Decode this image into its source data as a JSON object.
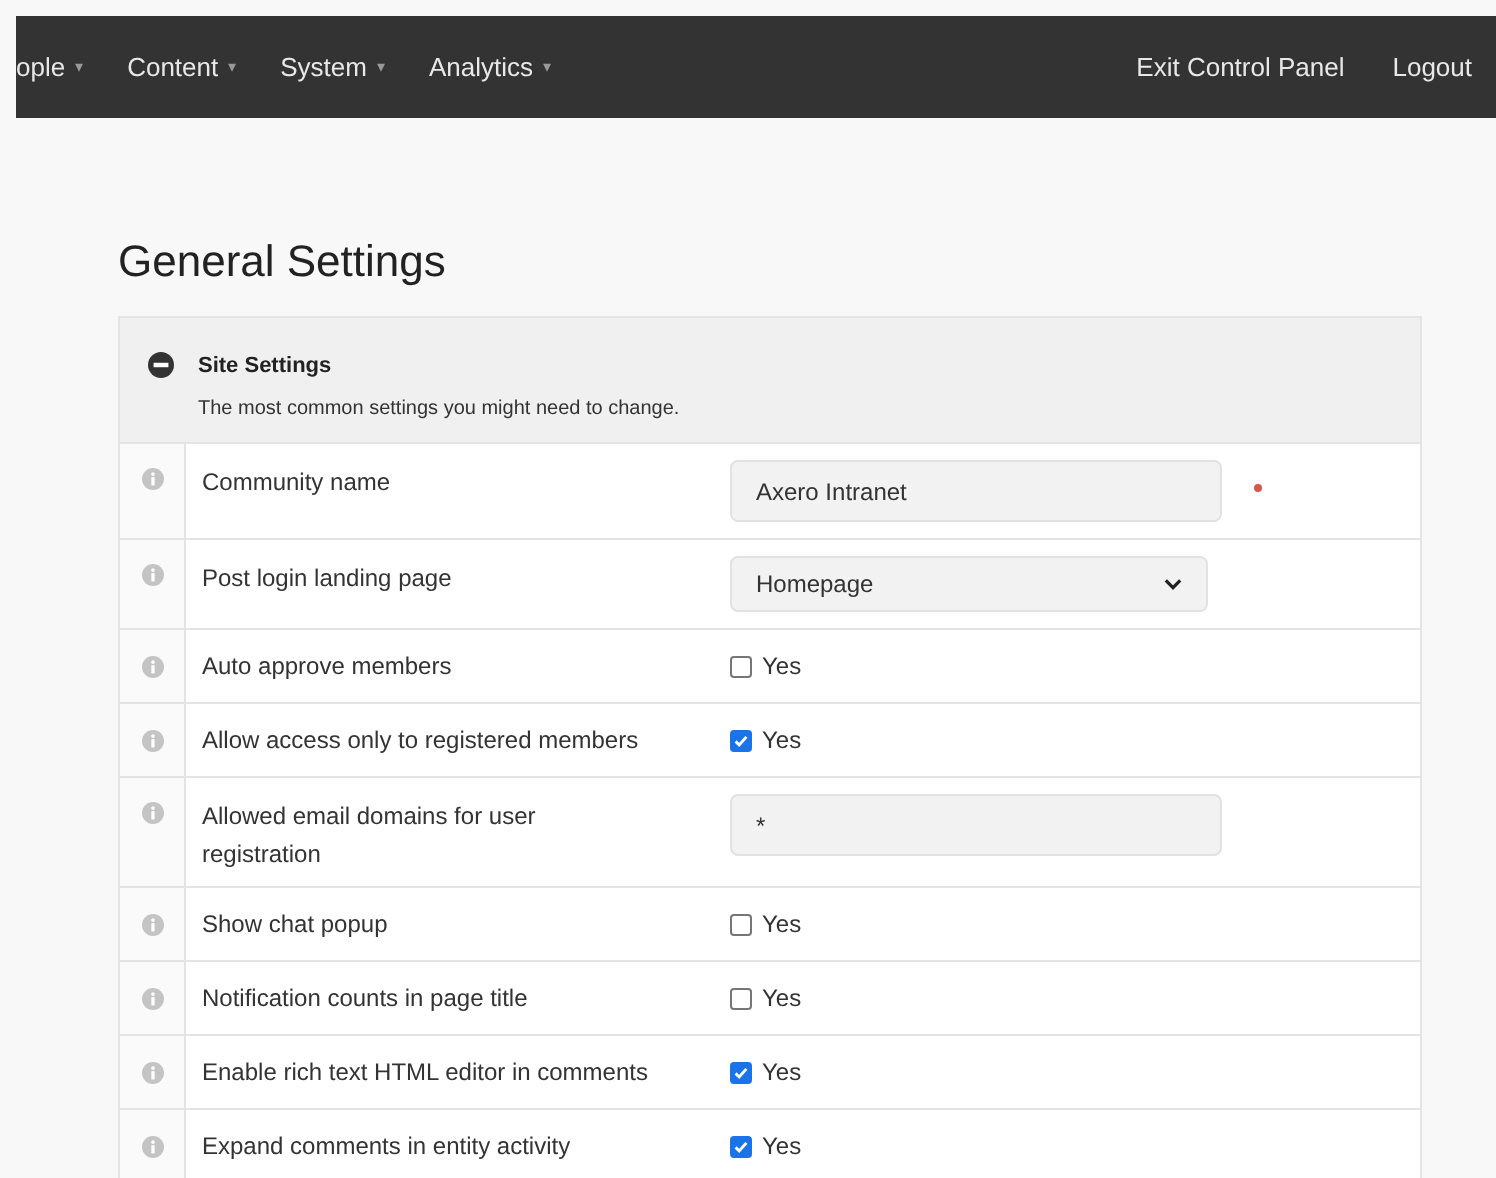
{
  "nav": {
    "left": [
      {
        "label": "ople",
        "caret": "▾"
      },
      {
        "label": "Content",
        "caret": "▾"
      },
      {
        "label": "System",
        "caret": "▾"
      },
      {
        "label": "Analytics",
        "caret": "▾"
      }
    ],
    "right": [
      "Exit Control Panel",
      "Logout"
    ]
  },
  "page_title": "General Settings",
  "section": {
    "title": "Site Settings",
    "description": "The most common settings you might need to change.",
    "expanded": true,
    "rows": [
      {
        "kind": "text",
        "label": "Community name",
        "value": "Axero Intranet",
        "required": true
      },
      {
        "kind": "select",
        "label": "Post login landing page",
        "value": "Homepage"
      },
      {
        "kind": "checkbox",
        "label": "Auto approve members",
        "checked": false,
        "option": "Yes"
      },
      {
        "kind": "checkbox",
        "label": "Allow access only to registered members",
        "checked": true,
        "option": "Yes"
      },
      {
        "kind": "text",
        "label": "Allowed email domains for user registration",
        "value": "*",
        "required": false
      },
      {
        "kind": "checkbox",
        "label": "Show chat popup",
        "checked": false,
        "option": "Yes"
      },
      {
        "kind": "checkbox",
        "label": "Notification counts in page title",
        "checked": false,
        "option": "Yes"
      },
      {
        "kind": "checkbox",
        "label": "Enable rich text HTML editor in comments",
        "checked": true,
        "option": "Yes"
      },
      {
        "kind": "checkbox",
        "label": "Expand comments in entity activity",
        "checked": true,
        "option": "Yes"
      }
    ]
  }
}
